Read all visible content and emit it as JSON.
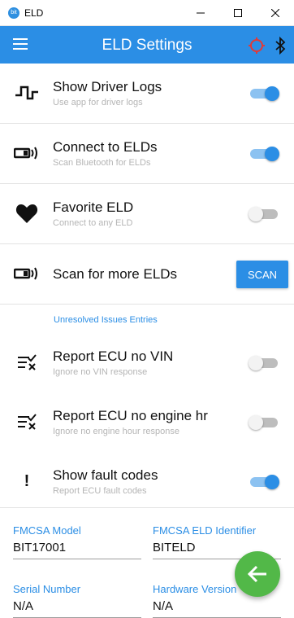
{
  "window": {
    "app_icon_text": "bit",
    "title": "ELD"
  },
  "appbar": {
    "title": "ELD Settings",
    "icons": [
      "menu-icon",
      "crosshair-icon",
      "bluetooth-icon"
    ],
    "accent_color": "#2b8ee5",
    "crosshair_color": "#e53935"
  },
  "settings": {
    "show_driver_logs": {
      "title": "Show Driver Logs",
      "subtitle": "Use app for driver logs",
      "enabled": true,
      "icon": "square-wave-icon"
    },
    "connect_to_elds": {
      "title": "Connect to ELDs",
      "subtitle": "Scan Bluetooth for ELDs",
      "enabled": true,
      "icon": "eld-broadcast-icon"
    },
    "favorite_eld": {
      "title": "Favorite ELD",
      "subtitle": "Connect to any ELD",
      "enabled": false,
      "icon": "heart-icon"
    },
    "scan_more": {
      "title": "Scan for more ELDs",
      "button_label": "SCAN",
      "icon": "eld-broadcast-icon"
    },
    "unresolved_header": "Unresolved Issues Entries",
    "report_no_vin": {
      "title": "Report ECU no VIN",
      "subtitle": "Ignore no VIN response",
      "enabled": false,
      "icon": "clear-list-icon"
    },
    "report_no_engine_hr": {
      "title": "Report ECU no engine hr",
      "subtitle": "Ignore no engine hour response",
      "enabled": false,
      "icon": "clear-list-icon"
    },
    "show_fault_codes": {
      "title": "Show fault codes",
      "subtitle": "Report ECU fault codes",
      "enabled": true,
      "icon": "exclamation-icon",
      "icon_glyph": "!"
    }
  },
  "fields": {
    "fmcsa_model": {
      "label": "FMCSA Model",
      "value": "BIT17001"
    },
    "fmcsa_eld_identifier": {
      "label": "FMCSA ELD Identifier",
      "value": "BITELD"
    },
    "serial_number": {
      "label": "Serial Number",
      "value": "N/A"
    },
    "hardware_version": {
      "label": "Hardware Version",
      "value": "N/A"
    }
  },
  "fab": {
    "icon": "arrow-left-icon",
    "color": "#52b848"
  }
}
